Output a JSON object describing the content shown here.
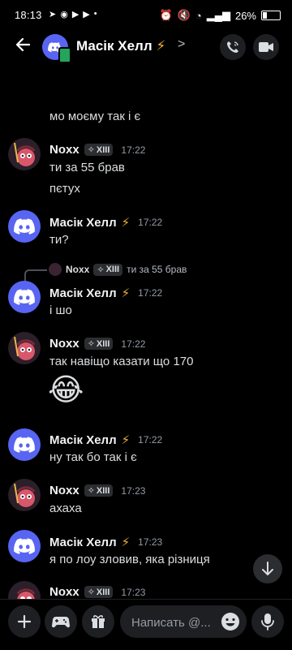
{
  "status": {
    "time": "18:13",
    "battery": "26%"
  },
  "header": {
    "title": "Масік Хелл",
    "title_emoji": "⚡",
    "chevron": ">"
  },
  "messages": [
    {
      "type": "continuation",
      "text": "мо моєму так і є"
    },
    {
      "type": "group",
      "author": "Noxx",
      "tag": "XIII",
      "time": "17:22",
      "lines": [
        "ти за 55 брав",
        "пєтух"
      ]
    },
    {
      "type": "group",
      "author": "Масік Хелл",
      "emoji": "⚡",
      "time": "17:22",
      "lines": [
        "ти?"
      ]
    },
    {
      "type": "reply",
      "reply_author": "Noxx",
      "reply_tag": "XIII",
      "reply_text": "ти за 55 брав",
      "author": "Масік Хелл",
      "emoji": "⚡",
      "time": "17:22",
      "lines": [
        "і шо"
      ]
    },
    {
      "type": "group",
      "author": "Noxx",
      "tag": "XIII",
      "time": "17:22",
      "lines": [
        "так навіщо казати що 170"
      ],
      "emoji_message": "😂"
    },
    {
      "type": "group",
      "author": "Масік Хелл",
      "emoji": "⚡",
      "time": "17:22",
      "lines": [
        "ну так бо так і є"
      ]
    },
    {
      "type": "group",
      "author": "Noxx",
      "tag": "XIII",
      "time": "17:23",
      "lines": [
        "ахаха"
      ]
    },
    {
      "type": "group",
      "author": "Масік Хелл",
      "emoji": "⚡",
      "time": "17:23",
      "lines": [
        "я по лоу зловив, яка різниця"
      ]
    },
    {
      "type": "group",
      "author": "Noxx",
      "tag": "XIII",
      "time": "17:23",
      "lines": []
    }
  ],
  "composer": {
    "placeholder": "Написать @..."
  },
  "icons": [
    "back-arrow-icon",
    "phone-call-icon",
    "video-call-icon",
    "plus-icon",
    "gamepad-icon",
    "gift-icon",
    "emoji-icon",
    "microphone-icon",
    "scroll-down-icon"
  ],
  "colors": {
    "blurple": "#5865f2",
    "bolt": "#f0b232",
    "background": "#000000"
  }
}
